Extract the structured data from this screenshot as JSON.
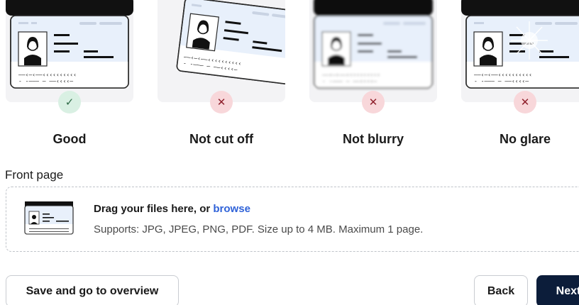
{
  "examples": [
    {
      "label": "Good",
      "status": "ok",
      "mark": "✓"
    },
    {
      "label": "Not cut off",
      "status": "bad",
      "mark": "✕"
    },
    {
      "label": "Not blurry",
      "status": "bad",
      "mark": "✕"
    },
    {
      "label": "No glare",
      "status": "bad",
      "mark": "✕"
    }
  ],
  "upload": {
    "section_label": "Front page",
    "title_prefix": "Drag your files here, or ",
    "browse_label": "browse",
    "supports": "Supports: JPG, JPEG, PNG, PDF. Size up to 4 MB. Maximum 1 page."
  },
  "actions": {
    "save_label": "Save and go to overview",
    "back_label": "Back",
    "next_label": "Next"
  },
  "colors": {
    "ok_badge": "#d9f0e3",
    "bad_badge": "#f8d7da",
    "link": "#2f62d8",
    "primary": "#0c1d3a"
  }
}
